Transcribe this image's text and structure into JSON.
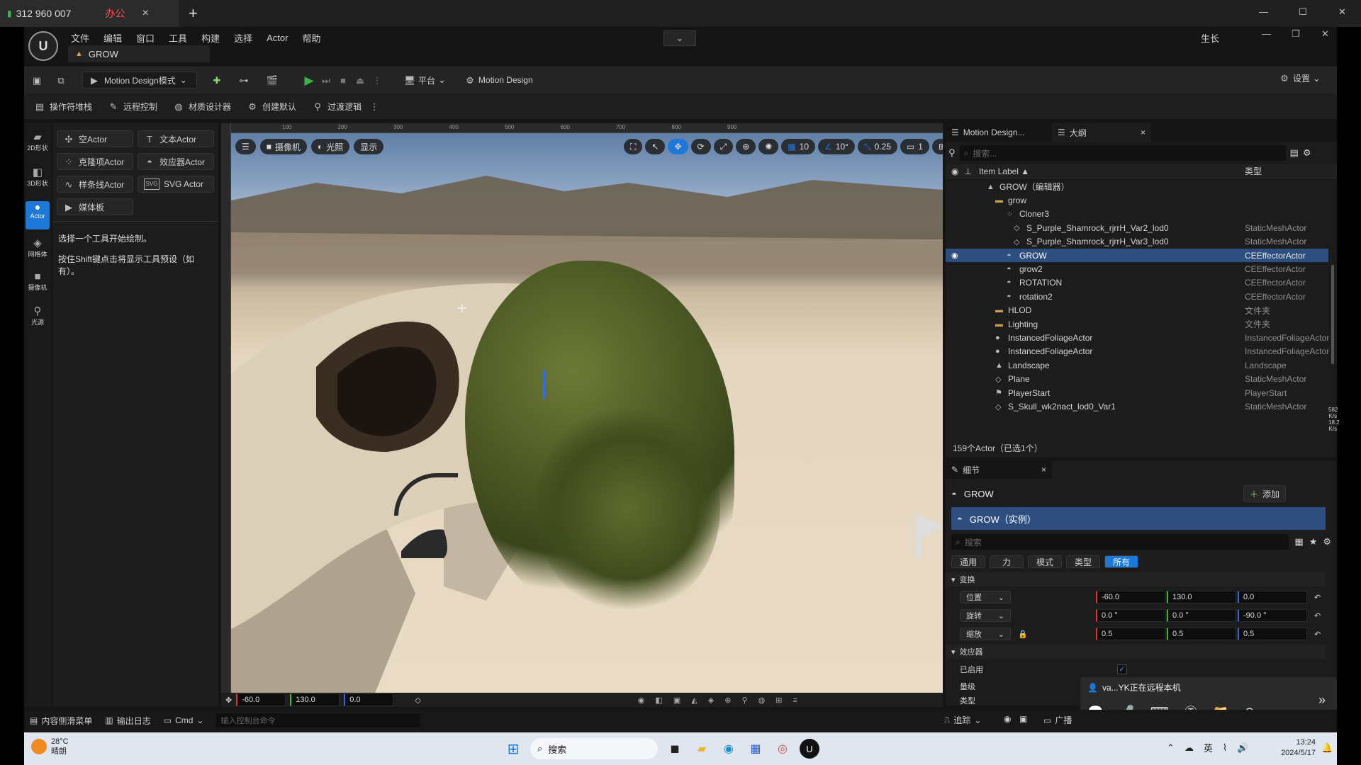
{
  "remote": {
    "signal": "312 960 007",
    "tag": "办公",
    "close": "×",
    "new_tab": "+",
    "min": "—",
    "max": "☐",
    "close_win": "✕"
  },
  "ue": {
    "logo": "U",
    "menu": [
      "文件",
      "编辑",
      "窗口",
      "工具",
      "构建",
      "选择",
      "Actor",
      "帮助"
    ],
    "user": "生长",
    "level_tab": "GROW",
    "toolbar": {
      "mode": "Motion Design模式",
      "platform": "平台",
      "motion_design": "Motion Design",
      "settings": "设置"
    },
    "toolbar2": [
      "操作符堆栈",
      "远程控制",
      "材质设计器",
      "创建默认",
      "过渡逻辑"
    ],
    "modes": [
      "2D形状",
      "3D形状",
      "Actor",
      "网格体",
      "摄像机",
      "光源"
    ],
    "actor_buttons": [
      "空Actor",
      "文本Actor",
      "克隆项Actor",
      "效应器Actor",
      "样条线Actor",
      "SVG Actor",
      "媒体板"
    ],
    "hint1": "选择一个工具开始绘制。",
    "hint2": "按住Shift键点击将显示工具预设（如有）。",
    "viewport": {
      "camera": "摄像机",
      "lit": "光照",
      "show": "显示",
      "ruler": [
        "100",
        "200",
        "300",
        "400",
        "500",
        "600",
        "700",
        "800",
        "900"
      ],
      "grid": "10",
      "angle": "10°",
      "scale": "0.25",
      "cam_speed": "1",
      "coords": [
        "-60.0",
        "130.0",
        "0.0"
      ]
    },
    "outliner": {
      "tab1": "Motion Design...",
      "tab2": "大纲",
      "search_placeholder": "搜索...",
      "col_label": "Item Label ▲",
      "col_type": "类型",
      "rows": [
        {
          "label": "GROW（编辑器）",
          "type": ""
        },
        {
          "label": "grow",
          "type": ""
        },
        {
          "label": "Cloner3",
          "type": ""
        },
        {
          "label": "S_Purple_Shamrock_rjrrH_Var2_lod0",
          "type": "StaticMeshActor"
        },
        {
          "label": "S_Purple_Shamrock_rjrrH_Var3_lod0",
          "type": "StaticMeshActor"
        },
        {
          "label": "GROW",
          "type": "CEEffectorActor"
        },
        {
          "label": "grow2",
          "type": "CEEffectorActor"
        },
        {
          "label": "ROTATION",
          "type": "CEEffectorActor"
        },
        {
          "label": "rotation2",
          "type": "CEEffectorActor"
        },
        {
          "label": "HLOD",
          "type": "文件夹"
        },
        {
          "label": "Lighting",
          "type": "文件夹"
        },
        {
          "label": "InstancedFoliageActor",
          "type": "InstancedFoliageActor"
        },
        {
          "label": "InstancedFoliageActor",
          "type": "InstancedFoliageActor"
        },
        {
          "label": "Landscape",
          "type": "Landscape"
        },
        {
          "label": "Plane",
          "type": "StaticMeshActor"
        },
        {
          "label": "PlayerStart",
          "type": "PlayerStart"
        },
        {
          "label": "S_Skull_wk2nact_lod0_Var1",
          "type": "StaticMeshActor"
        }
      ],
      "footer": "159个Actor（已选1个）",
      "stats": [
        "582",
        "K/s",
        "18.2",
        "K/s"
      ]
    },
    "details": {
      "tab": "细节",
      "name": "GROW",
      "add": "添加",
      "instance": "GROW（实例）",
      "search_placeholder": "搜索",
      "filters": [
        "通用",
        "力",
        "模式",
        "类型",
        "所有"
      ],
      "section_transform": "变换",
      "location_label": "位置",
      "rotation_label": "旋转",
      "scale_label": "缩放",
      "location": [
        "-60.0",
        "130.0",
        "0.0"
      ],
      "rotation": [
        "0.0 °",
        "0.0 °",
        "-90.0 °"
      ],
      "scale": [
        "0.5",
        "0.5",
        "0.5"
      ],
      "section_effector": "效应器",
      "enabled_label": "已启用",
      "mag_label": "量级",
      "type_label": "类型"
    },
    "bottom": {
      "content": "内容侧滑菜单",
      "log": "输出日志",
      "cmd": "Cmd",
      "console_placeholder": "输入控制台命令",
      "trace": "追踪",
      "broadcast": "广播"
    },
    "remote_popup": {
      "text": "va...YK正在远程本机"
    }
  },
  "taskbar": {
    "temp": "28°C",
    "weather": "晴朗",
    "search": "搜索",
    "lang": "英",
    "time": "13:24",
    "date": "2024/5/17"
  },
  "colors": {
    "selected": "#2d4e7e",
    "accent": "#1e78d7",
    "play": "#3bb54a"
  }
}
